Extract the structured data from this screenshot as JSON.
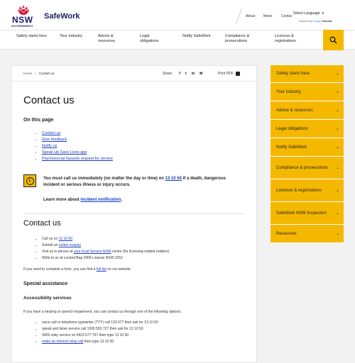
{
  "header": {
    "logo_text": "NSW",
    "logo_subtext": "GOVERNMENT",
    "site_title": "SafeWork",
    "util_links": [
      "About",
      "News",
      "Contac"
    ],
    "language_select": "Select Language",
    "powered_by": "Powered by",
    "google": "Google",
    "translate": "Translate"
  },
  "nav": {
    "items": [
      {
        "label": "Safety starts here"
      },
      {
        "label": "Your industry"
      },
      {
        "label": "Advice & resources"
      },
      {
        "label": "Legal obligations"
      },
      {
        "label": "Notify SafeWork"
      },
      {
        "label": "Compliance & prosecutions"
      },
      {
        "label": "Licences & registrations"
      }
    ],
    "search_icon": "search-icon"
  },
  "breadcrumb": {
    "home": "Home",
    "sep": "/",
    "current": "Contact us"
  },
  "share": {
    "label": "Share",
    "icons": [
      "f",
      "t",
      "in",
      "✉"
    ]
  },
  "print_pdf": "Print PDF",
  "page": {
    "title": "Contact us",
    "on_this_page": "On this page",
    "toc": [
      "Contact us",
      "Give feedback",
      "Notify us",
      "Speak Up Save Lives app",
      "Psychosocial hazards request for service"
    ],
    "alert": {
      "text_before": "You must call us immediately (no matter the day or time) on ",
      "phone": "13 10 50",
      "text_after": " if a death, dangerous incident or serious illness or injury occurs.",
      "more_before": "Learn more about ",
      "more_link": "incident notification",
      "more_after": "."
    },
    "contact_heading": "Contact us",
    "contact_list": [
      {
        "before": "Call us on ",
        "link": "13 10 50",
        "after": ""
      },
      {
        "before": "Submit an ",
        "link": "online enquiry",
        "after": ""
      },
      {
        "before": "Visit us in person at ",
        "link": "your local Service NSW",
        "after": " centre (for licensing-related matters)"
      },
      {
        "before": "Write to us at Locked Bag 2906 Lisarow NSW 2252",
        "link": "",
        "after": ""
      }
    ],
    "form_para_before": "If you need to complete a form, you can find a ",
    "form_para_link": "full list",
    "form_para_after": " on our website.",
    "special_assistance": "Special assistance",
    "accessibility_services": "Accessibility services",
    "access_para": "If you have a hearing or speech impairment, you can contact us through one of the following options:",
    "access_list": [
      {
        "before": "voice call or telephone typewriter (TTY) call 133 677 then ask for 13 10 50",
        "link": "",
        "after": ""
      },
      {
        "before": "speak and listen service call 1300 555 727 then ask for 13 10 50",
        "link": "",
        "after": ""
      },
      {
        "before": "SMS relay service on 0423 677 767 then type 13 10 50",
        "link": "",
        "after": ""
      },
      {
        "before": "",
        "link": "make an internet relay call",
        "after": " then type 13 10 50"
      }
    ]
  },
  "side_menu": [
    {
      "label": "Safety starts here"
    },
    {
      "label": "Your industry"
    },
    {
      "label": "Advice & resources"
    },
    {
      "label": "Legal obligations"
    },
    {
      "label": "Notify SafeWork"
    },
    {
      "label": "Compliance & prosecutions"
    },
    {
      "label": "Licences & registrations"
    },
    {
      "label": "SafeWork NSW Inspectors"
    },
    {
      "label": "Resources"
    }
  ],
  "colors": {
    "accent": "#f5b800",
    "brand": "#1b1b5e",
    "link": "#1a3bbf"
  }
}
